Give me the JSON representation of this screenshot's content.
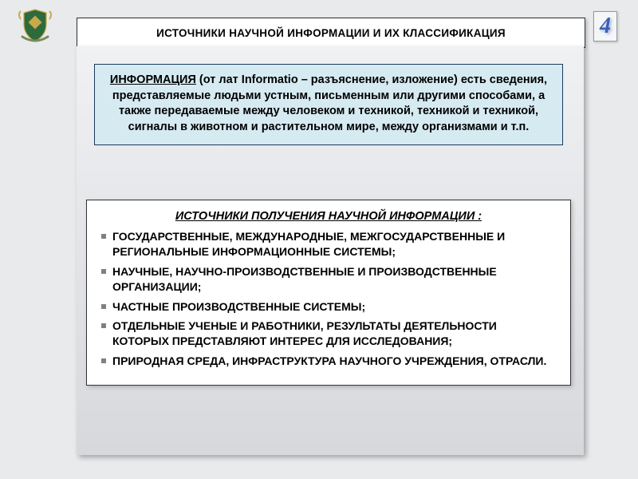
{
  "page_number": "4",
  "title": "ИСТОЧНИКИ НАУЧНОЙ ИНФОРМАЦИИ И ИХ КЛАССИФИКАЦИЯ",
  "info": {
    "lead_word": "ИНФОРМАЦИЯ",
    "body": " (от лат Informatio – разъяснение, изложение) есть сведения, представляемые людьми устным, письменным или другими способами, а также передаваемые между человеком и техникой, техникой и техникой, сигналы в животном и растительном мире, между организмами и т.п."
  },
  "sources": {
    "heading": "ИСТОЧНИКИ ПОЛУЧЕНИЯ НАУЧНОЙ ИНФОРМАЦИИ :",
    "items": [
      "ГОСУДАРСТВЕННЫЕ, МЕЖДУНАРОДНЫЕ, МЕЖГОСУДАРСТВЕННЫЕ И РЕГИОНАЛЬНЫЕ ИНФОРМАЦИОННЫЕ СИСТЕМЫ;",
      "НАУЧНЫЕ, НАУЧНО-ПРОИЗВОДСТВЕННЫЕ И ПРОИЗВОДСТВЕННЫЕ ОРГАНИЗАЦИИ;",
      "ЧАСТНЫЕ ПРОИЗВОДСТВЕННЫЕ СИСТЕМЫ;",
      "ОТДЕЛЬНЫЕ УЧЕНЫЕ И РАБОТНИКИ, РЕЗУЛЬТАТЫ ДЕЯТЕЛЬНОСТИ КОТОРЫХ ПРЕДСТАВЛЯЮТ ИНТЕРЕС ДЛЯ ИССЛЕДОВАНИЯ;",
      "ПРИРОДНАЯ СРЕДА, ИНФРАСТРУКТУРА НАУЧНОГО УЧРЕЖДЕНИЯ, ОТРАСЛИ."
    ]
  }
}
